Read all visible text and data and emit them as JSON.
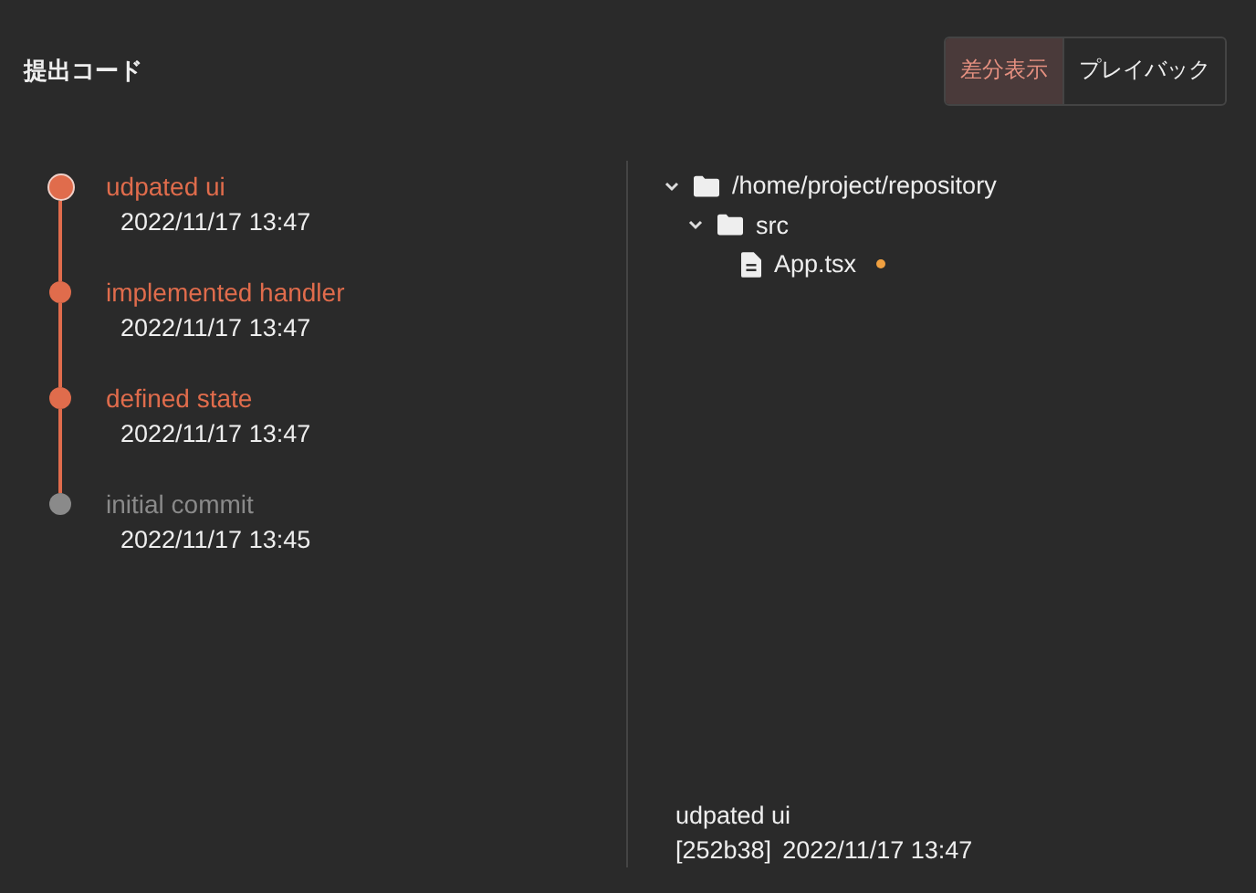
{
  "title": "提出コード",
  "view_tabs": [
    {
      "label": "差分表示",
      "selected": true
    },
    {
      "label": "プレイバック",
      "selected": false
    }
  ],
  "commits": [
    {
      "message": "udpated ui",
      "time": "2022/11/17 13:47",
      "selected": true,
      "applied": true
    },
    {
      "message": "implemented handler",
      "time": "2022/11/17 13:47",
      "selected": false,
      "applied": true
    },
    {
      "message": "defined state",
      "time": "2022/11/17 13:47",
      "selected": false,
      "applied": true
    },
    {
      "message": "initial commit",
      "time": "2022/11/17 13:45",
      "selected": false,
      "applied": false
    }
  ],
  "file_tree": [
    {
      "kind": "folder",
      "name": "/home/project/repository",
      "expanded": true,
      "children": [
        {
          "kind": "folder",
          "name": "src",
          "expanded": true,
          "children": [
            {
              "kind": "file",
              "name": "App.tsx",
              "modified": true
            }
          ]
        }
      ]
    }
  ],
  "detail": {
    "message": "udpated ui",
    "hash": "[252b38]",
    "time": "2022/11/17 13:47"
  }
}
